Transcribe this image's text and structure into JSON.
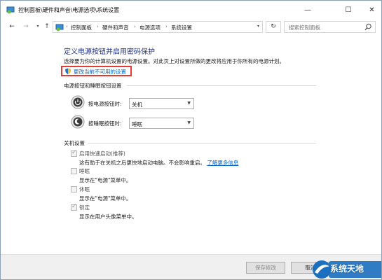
{
  "window": {
    "title": "控制面板\\硬件和声音\\电源选项\\系统设置",
    "controls": {
      "minimize": "—",
      "maximize": "☐",
      "close": "✕"
    }
  },
  "nav": {
    "back": "←",
    "forward": "→",
    "up": "↑",
    "breadcrumbs": [
      "控制面板",
      "硬件和声音",
      "电源选项",
      "系统设置"
    ],
    "separator": "›",
    "refresh": "↻",
    "search_placeholder": "搜索控制面板"
  },
  "main": {
    "heading": "定义电源按钮并启用密码保护",
    "subtext": "选择要为你的计算机设置的电源设置。对此页上对设置所做的更改将应用于你所有的电源计划。",
    "change_link": "更改当前不可用的设置",
    "power_section": {
      "title": "电源按钮和睡眠按钮设置",
      "rows": [
        {
          "label": "按电源按钮时:",
          "value": "关机",
          "icon": "power-icon"
        },
        {
          "label": "按睡眠按钮时:",
          "value": "睡眠",
          "icon": "sleep-icon"
        }
      ]
    },
    "shutdown_section": {
      "title": "关机设置",
      "items": [
        {
          "label": "启用快速启动(推荐)",
          "checked": true,
          "desc": "这有助于在关机之后更快地启动电脑。不会影响重启。",
          "link": "了解更多信息"
        },
        {
          "label": "睡眠",
          "checked": false,
          "desc": "显示在\"电源\"菜单中。"
        },
        {
          "label": "休眠",
          "checked": false,
          "desc": "显示在\"电源\"菜单中。"
        },
        {
          "label": "锁定",
          "checked": true,
          "desc": "显示在用户头像菜单中。"
        }
      ]
    }
  },
  "footer": {
    "save_label": "保存修改",
    "cancel_label": "取消"
  },
  "watermark": {
    "text": "系统天地"
  },
  "colors": {
    "heading": "#1e3287",
    "link": "#0066cc",
    "highlight_box": "#e23b36"
  }
}
